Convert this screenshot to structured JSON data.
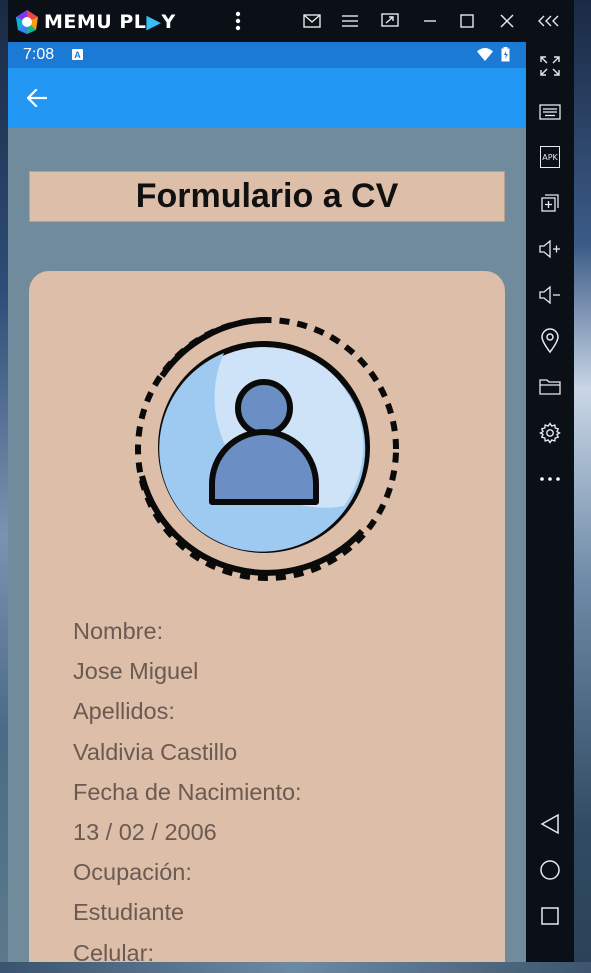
{
  "emulator": {
    "brand_memu": "MEMU PL",
    "brand_ay": "Y",
    "titlebar_icons": [
      "more-vert-icon",
      "mail-icon",
      "menu-icon",
      "screen-share-icon",
      "minimize-icon",
      "maximize-icon",
      "close-icon",
      "collapse-icon"
    ],
    "toolbar_icons": [
      "fullscreen-icon",
      "keyboard-icon",
      "apk-icon",
      "multi-instance-icon",
      "volume-up-icon",
      "volume-down-icon",
      "location-icon",
      "folder-icon",
      "settings-icon",
      "more-horiz-icon",
      "nav-back-icon",
      "nav-home-icon",
      "nav-recents-icon"
    ],
    "apk_label": "APK"
  },
  "statusbar": {
    "time": "7:08",
    "notification_letter": "A"
  },
  "page": {
    "title": "Formulario a CV"
  },
  "cv": {
    "fields": [
      {
        "label": "Nombre:",
        "value": "Jose Miguel"
      },
      {
        "label": "Apellidos:",
        "value": "Valdivia Castillo"
      },
      {
        "label": "Fecha de Nacimiento:",
        "value": "13 / 02 / 2006"
      },
      {
        "label": "Ocupación:",
        "value": "Estudiante"
      },
      {
        "label": "Celular:",
        "value": ""
      }
    ]
  },
  "colors": {
    "statusbar": "#1c7ad7",
    "appbar": "#2196f3",
    "screen_bg": "#708c9c",
    "card_bg": "#ddbea9",
    "field_text": "#6b5a52"
  }
}
